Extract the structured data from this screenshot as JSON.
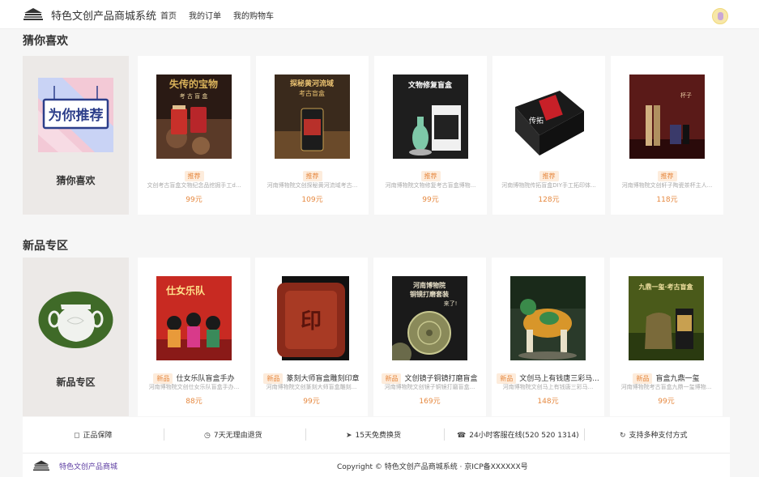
{
  "header": {
    "site_title": "特色文创产品商城系统",
    "nav": [
      "首页",
      "我的订单",
      "我的购物车"
    ]
  },
  "guess": {
    "title": "猜你喜欢",
    "banner_text": "为你推荐",
    "feature_label": "猜你喜欢",
    "items": [
      {
        "tag": "推荐",
        "desc": "文创考古盲盒文物纪念品挖掘手工d...",
        "price": "99元",
        "img_text": "失传的宝物 考古盲盒"
      },
      {
        "tag": "推荐",
        "desc": "河南博物院文创探秘黄河流域考古...",
        "price": "109元",
        "img_text": "探秘黄河流域 考古盲盒"
      },
      {
        "tag": "推荐",
        "desc": "河南博物院文物修复考古盲盒博物...",
        "price": "99元",
        "img_text": "文物修复盲盒"
      },
      {
        "tag": "推荐",
        "desc": "河南博物院传拓盲盒DIY手工拓印体...",
        "price": "128元",
        "img_text": "传拓"
      },
      {
        "tag": "推荐",
        "desc": "河南博物院文创轩子陶瓷茶杯主人...",
        "price": "118元",
        "img_text": "杯子"
      }
    ]
  },
  "newarrivals": {
    "title": "新品专区",
    "feature_label": "新品专区",
    "items": [
      {
        "tag": "新品",
        "name": "仕女乐队盲盒手办",
        "desc": "河南博物院文创仕女乐队盲盒手办...",
        "price": "88元",
        "img_text": "仕女乐队"
      },
      {
        "tag": "新品",
        "name": "篆刻大师盲盒雕刻印章",
        "desc": "河南博物院文创篆刻大师盲盒雕刻...",
        "price": "99元",
        "img_text": "印"
      },
      {
        "tag": "新品",
        "name": "文创镜子铜镜打磨盲盒",
        "desc": "河南博物院文创镜子铜镜打磨盲盒...",
        "price": "169元",
        "img_text": "河南博物院 铜镜打磨套装 来了!"
      },
      {
        "tag": "新品",
        "name": "文创马上有钱唐三彩马...",
        "desc": "河南博物院文创马上有钱唐三彩马...",
        "price": "148元",
        "img_text": "唐三彩马"
      },
      {
        "tag": "新品",
        "name": "盲盒九鼎一玺",
        "desc": "河南博物院考古盲盒九鼎一玺博物...",
        "price": "99元",
        "img_text": "九鼎一玺·考古盲盒"
      }
    ]
  },
  "services": [
    {
      "icon": "shield-icon",
      "label": "正品保障"
    },
    {
      "icon": "clock-icon",
      "label": "7天无理由退货"
    },
    {
      "icon": "send-icon",
      "label": "15天免费换货"
    },
    {
      "icon": "headset-icon",
      "label": "24小时客服在线(520 520 1314)"
    },
    {
      "icon": "refresh-icon",
      "label": "支持多种支付方式"
    }
  ],
  "footer": {
    "site_name": "特色文创产品商城",
    "copyright": "Copyright © 特色文创产品商城系统 · 京ICP备XXXXXX号"
  },
  "colors": {
    "accent": "#e6883f",
    "tag_bg": "#fdecdc",
    "footer_link": "#5a3aa0"
  }
}
